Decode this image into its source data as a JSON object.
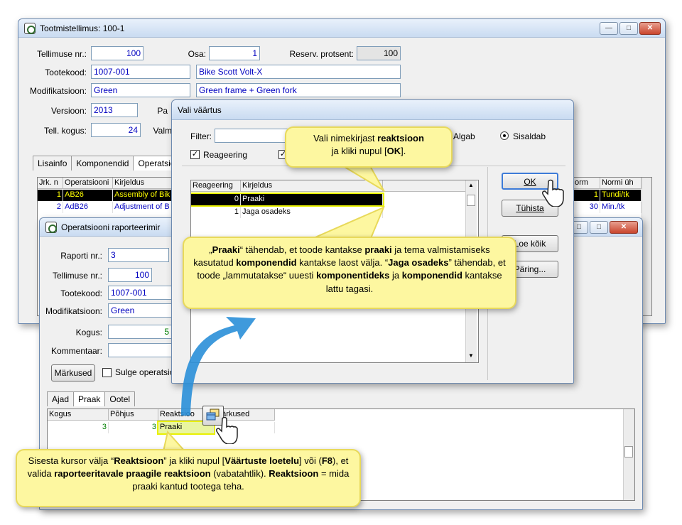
{
  "main_window": {
    "title": "Tootmistellimus: 100-1",
    "labels": {
      "order_no": "Tellimuse nr.:",
      "part": "Osa:",
      "reserve": "Reserv. protsent:",
      "product_code": "Tootekood:",
      "modification": "Modifikatsioon:",
      "version": "Versioon:",
      "pa": "Pa",
      "qty": "Tell. kogus:",
      "valm": "Valm"
    },
    "values": {
      "order_no": "100",
      "part": "1",
      "reserve": "100",
      "product_code": "1007-001",
      "product_name": "Bike Scott Volt-X",
      "modification": "Green",
      "modification_desc": "Green frame + Green fork",
      "version": "2013",
      "qty": "24"
    },
    "tabs": [
      "Lisainfo",
      "Komponendid",
      "Operatsio"
    ],
    "grid": {
      "headers": [
        "Jrk. n",
        "Operatsiooni",
        "Kirjeldus"
      ],
      "rows": [
        {
          "jrk": "1",
          "op": "AB26",
          "desc": "Assembly of Bik"
        },
        {
          "jrk": "2",
          "op": "AdB26",
          "desc": "Adjustment of B"
        }
      ],
      "right_headers": [
        "orm",
        "Normi üh"
      ],
      "right_rows": [
        {
          "norm": "1",
          "unit": "Tundi/tk"
        },
        {
          "norm": "30",
          "unit": "Min./tk"
        }
      ]
    }
  },
  "report_window": {
    "title": "Operatsiooni raporteerimir",
    "labels": {
      "report_no": "Raporti nr.:",
      "order_no": "Tellimuse nr.:",
      "product_code": "Tootekood:",
      "modification": "Modifikatsioon:",
      "qty": "Kogus:",
      "comment": "Kommentaar:"
    },
    "values": {
      "report_no": "3",
      "order_no": "100",
      "product_code": "1007-001",
      "modification": "Green",
      "qty": "5"
    },
    "notes_button": "Märkused",
    "close_op_checkbox": "Sulge operatsio",
    "tabs": [
      "Ajad",
      "Praak",
      "Ootel"
    ],
    "grid": {
      "headers": [
        "Kogus",
        "Põhjus",
        "Reaktsioo",
        "Märkused"
      ],
      "row": {
        "qty": "3",
        "reason": "3",
        "reaction": "Praaki"
      }
    }
  },
  "pick_dialog": {
    "title": "Vali väärtus",
    "filter_label": "Filter:",
    "filter_value": "",
    "opt_starts": "Algab",
    "opt_contains": "Sisaldab",
    "check_reaction": "Reageering",
    "list_headers": [
      "Reageering",
      "Kirjeldus"
    ],
    "rows": [
      {
        "code": "0",
        "desc": "Praaki"
      },
      {
        "code": "1",
        "desc": "Jaga osadeks"
      }
    ],
    "buttons": {
      "ok": "OK",
      "cancel": "Tühista",
      "read_all": "Loe kõik",
      "query": "Päring..."
    }
  },
  "callouts": {
    "top_pre": "Vali nimekirjast ",
    "top_b1": "reaktsioon",
    "top_mid": "ja kliki nupul [",
    "top_b2": "OK",
    "top_end": "].",
    "mid_q1": "„",
    "mid_b1": "Praaki",
    "mid_t1": "“  tähendab, et toode kantakse ",
    "mid_b2": "praaki",
    "mid_t2": " ja tema valmistamiseks kasutatud ",
    "mid_b3": "komponendid",
    "mid_t3": "  kantakse laost välja.",
    "mid_q2": "“",
    "mid_b4": "Jaga osadeks",
    "mid_t4": "” tähendab, et toode „lammutatakse“ uuesti ",
    "mid_b5": "komponentideks",
    "mid_t5": " ja ",
    "mid_b6": "komponendid",
    "mid_t6": "  kantakse lattu tagasi.",
    "bot_t1": "Sisesta kursor välja “",
    "bot_b1": "Reaktsioon",
    "bot_t2": "” ja kliki nupul [",
    "bot_b2": "Väärtuste loetelu",
    "bot_t3": "] või (",
    "bot_b3": "F8",
    "bot_t4": "), et valida ",
    "bot_b4": "raporteeritavale praagile reaktsioon",
    "bot_t5": " (vabatahtlik). ",
    "bot_b5": "Reaktsioon",
    "bot_t6": " = mida praaki kantud tootega teha."
  },
  "colors": {
    "highlight_row": "#000000",
    "highlight_outline": "#e8f000",
    "callout_bg": "#fdf7a0",
    "value_text": "#0000c0",
    "arrow": "#2a8fd8"
  }
}
